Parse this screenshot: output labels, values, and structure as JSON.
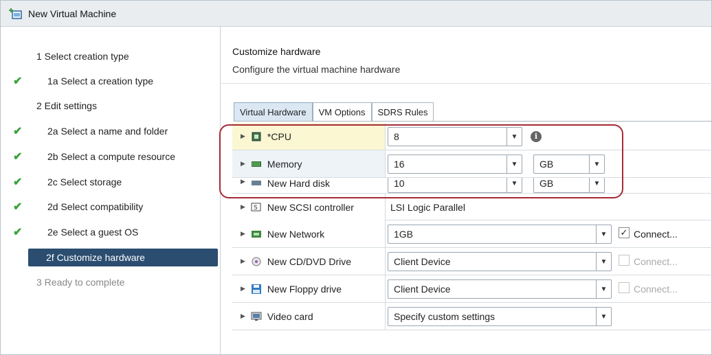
{
  "window": {
    "title": "New Virtual Machine",
    "icon": "new-vm-icon"
  },
  "sidebar": {
    "steps": [
      {
        "label": "1  Select creation type",
        "check": false,
        "top": true
      },
      {
        "label": "1a  Select a creation type",
        "check": true
      },
      {
        "label": "2  Edit settings",
        "check": false,
        "top": true
      },
      {
        "label": "2a  Select a name and folder",
        "check": true
      },
      {
        "label": "2b  Select a compute resource",
        "check": true
      },
      {
        "label": "2c  Select storage",
        "check": true
      },
      {
        "label": "2d  Select compatibility",
        "check": true
      },
      {
        "label": "2e  Select a guest OS",
        "check": true
      },
      {
        "label": "2f  Customize hardware",
        "active": true
      },
      {
        "label": "3  Ready to complete",
        "disabled": true
      }
    ],
    "check_glyph": "✔"
  },
  "content": {
    "title": "Customize hardware",
    "subtitle": "Configure the virtual machine hardware"
  },
  "tabs": [
    {
      "label": "Virtual Hardware",
      "active": true
    },
    {
      "label": "VM Options",
      "active": false
    },
    {
      "label": "SDRS Rules",
      "active": false
    }
  ],
  "hardware": {
    "cpu": {
      "label": "*CPU",
      "value": "8",
      "icon": "cpu-icon",
      "info": "i"
    },
    "memory": {
      "label": "Memory",
      "value": "16",
      "unit": "GB",
      "icon": "memory-icon"
    },
    "hard_disk": {
      "label": "New Hard disk",
      "value": "10",
      "unit": "GB",
      "icon": "hard-disk-icon"
    },
    "scsi": {
      "label": "New SCSI controller",
      "value": "LSI Logic Parallel",
      "icon": "scsi-controller-icon"
    },
    "network": {
      "label": "New Network",
      "value": "1GB",
      "connect": "Connect...",
      "connected": true,
      "icon": "network-icon"
    },
    "cddvd": {
      "label": "New CD/DVD Drive",
      "value": "Client Device",
      "connect": "Connect...",
      "connected": false,
      "icon": "cd-dvd-icon"
    },
    "floppy": {
      "label": "New Floppy drive",
      "value": "Client Device",
      "connect": "Connect...",
      "connected": false,
      "icon": "floppy-icon"
    },
    "video": {
      "label": "Video card",
      "value": "Specify custom settings",
      "icon": "video-card-icon"
    }
  },
  "colors": {
    "active_step": "#2a4d70",
    "check": "#3aa23a",
    "highlight": "#a52a35",
    "active_tab": "#dbe8f3"
  }
}
